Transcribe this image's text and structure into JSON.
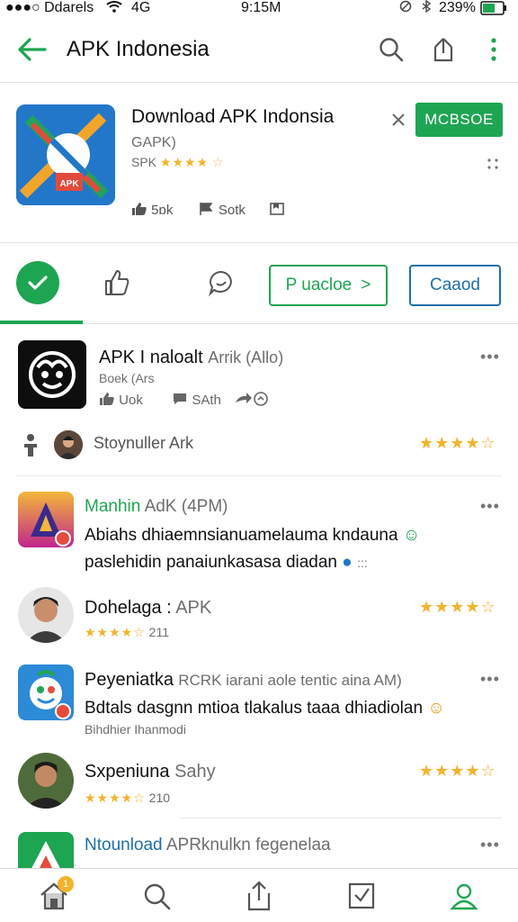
{
  "status_bar": {
    "carrier": "●●●○ Ddarels",
    "network": "4G",
    "time": "9:15M",
    "battery": "239%"
  },
  "app_bar": {
    "title": "APK Indonesia",
    "back_icon": "arrow-left-icon",
    "search_icon": "search-icon",
    "share_icon": "share-icon",
    "menu_icon": "more-vertical-icon"
  },
  "hero": {
    "title": "Download APK  Indonsia",
    "subtitle": "GAPK)",
    "rating_prefix": "SPK",
    "stars": "★★★★",
    "half_star": "☆",
    "stat1": "5ɒk",
    "stat2": "Sotk",
    "install_label": "MCBSOE"
  },
  "actions": {
    "primary_label": "P uacloe",
    "primary_chevron": ">",
    "secondary_label": "Caaod"
  },
  "app_card": {
    "title": "APK I naloalt",
    "title_suffix": "Arrik (Allo)",
    "subtitle": "Boek (Ars",
    "stat1": "Uok",
    "stat2": "SAth",
    "reviewer_label": "Stoynuller Ark",
    "stars": "★★★★☆"
  },
  "feed": [
    {
      "name": "Manhin",
      "meta": "AdK (4PM)",
      "line1": "Abiahs dhiaemnsianuamelauma kndauna",
      "line2": "paslehidin panaiunkasasa diadan",
      "line2_suffix": ":::"
    },
    {
      "name": "Dohelaga :",
      "meta": "APK",
      "stars": "★★★★☆",
      "small_stars": "★★★★☆",
      "count": "211"
    },
    {
      "name": "Peyeniatka",
      "meta": "RCRK iarani  aole  tentic aina AM)",
      "line1": "Bdtals dasgnn mtioa tlakalus taaa dhiadiolan",
      "line2": "Bihdhier Ihanmodi"
    },
    {
      "name": "Sxpeniuna",
      "meta": "Sahy",
      "stars": "★★★★☆",
      "small_stars": "★★★★☆",
      "count": "210"
    },
    {
      "name": "Ntounload",
      "meta": "APRknulkn fegenelaa"
    }
  ],
  "colors": {
    "accent_green": "#1ea552",
    "accent_blue": "#1f6fa8",
    "star_yellow": "#f2b42b"
  },
  "bottom_nav": {
    "items": [
      "home-icon",
      "search-icon",
      "share-icon",
      "check-box-icon",
      "profile-icon"
    ],
    "badge": "1"
  }
}
